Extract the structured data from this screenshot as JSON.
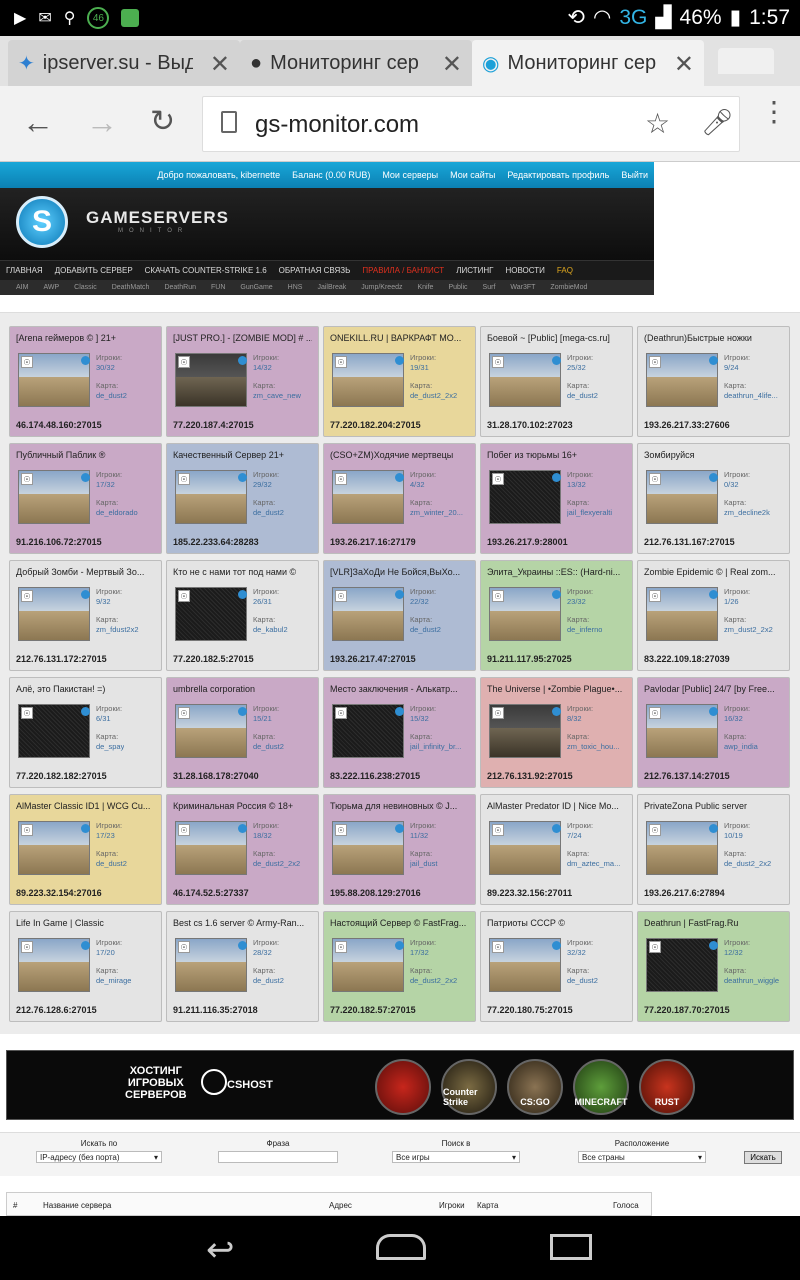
{
  "status": {
    "network": "3G",
    "battery": "46%",
    "time": "1:57",
    "notif_count": "46"
  },
  "tabs": [
    {
      "label": "ipserver.su - Выд"
    },
    {
      "label": "Мониторинг сер"
    },
    {
      "label": "Мониторинг сер"
    }
  ],
  "url": "gs-monitor.com",
  "site": {
    "userbar": {
      "welcome": "Добро пожаловать, kibernette",
      "balance": "Баланс (0.00 RUB)",
      "links": [
        "Мои серверы",
        "Мои сайты",
        "Редактировать профиль",
        "Выйти"
      ]
    },
    "logo_text": "GAMESERVERS",
    "logo_sub": "MONITOR",
    "menu": [
      "ГЛАВНАЯ",
      "ДОБАВИТЬ СЕРВЕР",
      "СКАЧАТЬ COUNTER-STRIKE 1.6",
      "ОБРАТНАЯ СВЯЗЬ",
      "ПРАВИЛА / БАНЛИСТ",
      "ЛИСТИНГ",
      "НОВОСТИ",
      "FAQ"
    ],
    "categories": [
      "AIM",
      "AWP",
      "Classic",
      "DeathMatch",
      "DeathRun",
      "FUN",
      "GunGame",
      "HNS",
      "JailBreak",
      "Jump/Kreedz",
      "Knife",
      "Public",
      "Surf",
      "War3FT",
      "ZombieMod"
    ]
  },
  "labels": {
    "players": "Игроки:",
    "map": "Карта:"
  },
  "servers": [
    {
      "title": "[Arena геймеров © ] 21+",
      "players": "30/32",
      "map": "de_dust2",
      "ip": "46.174.48.160:27015",
      "color": "#c9a9c6",
      "thumb": "map"
    },
    {
      "title": "[JUST PRO.] - [ZOMBIE MOD] # ...",
      "players": "14/32",
      "map": "zm_cave_new",
      "ip": "77.220.187.4:27015",
      "color": "#c9a9c6",
      "thumb": "dark"
    },
    {
      "title": "ONEKILL.RU | ВАРКРАФТ МО...",
      "players": "19/31",
      "map": "de_dust2_2x2",
      "ip": "77.220.182.204:27015",
      "color": "#e8d79b",
      "thumb": "map"
    },
    {
      "title": "Боевой ~ [Public] [mega-cs.ru]",
      "players": "25/32",
      "map": "de_dust2",
      "ip": "31.28.170.102:27023",
      "color": "#e4e4e4",
      "thumb": "map"
    },
    {
      "title": "(Deathrun)Быстрые ножки",
      "players": "9/24",
      "map": "deathrun_4life...",
      "ip": "193.26.217.33:27606",
      "color": "#e4e4e4",
      "thumb": "map"
    },
    {
      "title": "Публичный Паблик ®",
      "players": "17/32",
      "map": "de_eldorado",
      "ip": "91.216.106.72:27015",
      "color": "#c9a9c6",
      "thumb": "map"
    },
    {
      "title": "Качественный Сервер 21+",
      "players": "29/32",
      "map": "de_dust2",
      "ip": "185.22.233.64:28283",
      "color": "#aebbd3",
      "thumb": "map"
    },
    {
      "title": "(CSO+ZM)Ходячие мертвецы",
      "players": "4/32",
      "map": "zm_winter_20...",
      "ip": "193.26.217.16:27179",
      "color": "#c9a9c6",
      "thumb": "map"
    },
    {
      "title": "Побег из тюрьмы 16+",
      "players": "13/32",
      "map": "jail_flexyeralti",
      "ip": "193.26.217.9:28001",
      "color": "#c9a9c6",
      "thumb": "noise"
    },
    {
      "title": "Зомбируйся",
      "players": "0/32",
      "map": "zm_decline2k",
      "ip": "212.76.131.167:27015",
      "color": "#e4e4e4",
      "thumb": "map"
    },
    {
      "title": "Добрый Зомби - Мертвый Зо...",
      "players": "9/32",
      "map": "zm_fdust2x2",
      "ip": "212.76.131.172:27015",
      "color": "#e4e4e4",
      "thumb": "map"
    },
    {
      "title": "Кто не с нами тот под нами ©",
      "players": "26/31",
      "map": "de_kabul2",
      "ip": "77.220.182.5:27015",
      "color": "#e4e4e4",
      "thumb": "noise"
    },
    {
      "title": "[VLR]ЗаХоДи Не Бойся,ВыХо...",
      "players": "22/32",
      "map": "de_dust2",
      "ip": "193.26.217.47:27015",
      "color": "#aebbd3",
      "thumb": "map"
    },
    {
      "title": "Элита_Украины ::ES:: (Hard-ni...",
      "players": "23/32",
      "map": "de_inferno",
      "ip": "91.211.117.95:27025",
      "color": "#b5d4a6",
      "thumb": "map"
    },
    {
      "title": "Zombie Epidemic © | Real zom...",
      "players": "1/26",
      "map": "zm_dust2_2x2",
      "ip": "83.222.109.18:27039",
      "color": "#e4e4e4",
      "thumb": "map"
    },
    {
      "title": "Алё, это Пакистан! =)",
      "players": "6/31",
      "map": "de_spay",
      "ip": "77.220.182.182:27015",
      "color": "#e4e4e4",
      "thumb": "noise"
    },
    {
      "title": "umbrella corporation",
      "players": "15/21",
      "map": "de_dust2",
      "ip": "31.28.168.178:27040",
      "color": "#c9a9c6",
      "thumb": "map"
    },
    {
      "title": "Место заключения - Алькатр...",
      "players": "15/32",
      "map": "jail_infinity_br...",
      "ip": "83.222.116.238:27015",
      "color": "#c9a9c6",
      "thumb": "noise"
    },
    {
      "title": "The Universe | •Zombie Plague•...",
      "players": "8/32",
      "map": "zm_toxic_hou...",
      "ip": "212.76.131.92:27015",
      "color": "#dfb0b0",
      "thumb": "dark"
    },
    {
      "title": "Pavlodar [Public] 24/7 [by Free...",
      "players": "16/32",
      "map": "awp_india",
      "ip": "212.76.137.14:27015",
      "color": "#c9a9c6",
      "thumb": "map"
    },
    {
      "title": "AlMaster Classic ID1 | WCG Cu...",
      "players": "17/23",
      "map": "de_dust2",
      "ip": "89.223.32.154:27016",
      "color": "#e8d79b",
      "thumb": "map"
    },
    {
      "title": "Криминальная Россия © 18+",
      "players": "18/32",
      "map": "de_dust2_2x2",
      "ip": "46.174.52.5:27337",
      "color": "#c9a9c6",
      "thumb": "map"
    },
    {
      "title": "Тюрьма для невиновных © J...",
      "players": "11/32",
      "map": "jail_dust",
      "ip": "195.88.208.129:27016",
      "color": "#c9a9c6",
      "thumb": "map"
    },
    {
      "title": "AlMaster Predator ID | Nice Mo...",
      "players": "7/24",
      "map": "dm_aztec_ma...",
      "ip": "89.223.32.156:27011",
      "color": "#e4e4e4",
      "thumb": "map"
    },
    {
      "title": "PrivateZona Public server",
      "players": "10/19",
      "map": "de_dust2_2x2",
      "ip": "193.26.217.6:27894",
      "color": "#e4e4e4",
      "thumb": "map"
    },
    {
      "title": "Life In Game | Classic",
      "players": "17/20",
      "map": "de_mirage",
      "ip": "212.76.128.6:27015",
      "color": "#e4e4e4",
      "thumb": "map"
    },
    {
      "title": "Best cs 1.6 server © Army-Ran...",
      "players": "28/32",
      "map": "de_dust2",
      "ip": "91.211.116.35:27018",
      "color": "#e4e4e4",
      "thumb": "map"
    },
    {
      "title": "Настоящий Сервер © FastFrag...",
      "players": "17/32",
      "map": "de_dust2_2x2",
      "ip": "77.220.182.57:27015",
      "color": "#b5d4a6",
      "thumb": "map"
    },
    {
      "title": "Патриоты СССР ©",
      "players": "32/32",
      "map": "de_dust2",
      "ip": "77.220.180.75:27015",
      "color": "#e4e4e4",
      "thumb": "map"
    },
    {
      "title": "Deathrun | FastFrag.Ru",
      "players": "12/32",
      "map": "deathrun_wiggle",
      "ip": "77.220.187.70:27015",
      "color": "#b5d4a6",
      "thumb": "noise"
    }
  ],
  "banner": {
    "line1": "ХОСТИНГ",
    "line2": "ИГРОВЫХ",
    "line3": "СЕРВЕРОВ",
    "brand": "CSHOST",
    "games": [
      "",
      "Counter Strike",
      "CS:GO",
      "MINECRAFT",
      "RUST"
    ]
  },
  "search": {
    "by_label": "Искать по",
    "by_value": "IP-адресу (без порта)",
    "phrase_label": "Фраза",
    "in_label": "Поиск в",
    "in_value": "Все игры",
    "loc_label": "Расположение",
    "loc_value": "Все страны",
    "button": "Искать"
  },
  "list_head": {
    "num": "#",
    "name": "Название сервера",
    "address": "Адрес",
    "players": "Игроки",
    "map": "Карта",
    "votes": "Голоса"
  }
}
